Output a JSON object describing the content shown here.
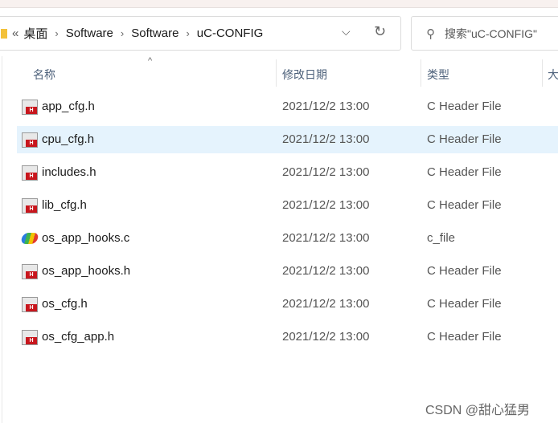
{
  "address_bar": {
    "overflow": "«",
    "crumbs": [
      "桌面",
      "Software",
      "Software",
      "uC-CONFIG"
    ],
    "separator": "›",
    "dropdown_icon": "chevron-down-icon",
    "refresh_icon": "refresh-icon"
  },
  "search": {
    "placeholder": "搜索\"uC-CONFIG\"",
    "icon": "search-icon"
  },
  "columns": {
    "name": "名称",
    "date": "修改日期",
    "type": "类型",
    "size": "大",
    "sort_indicator": "^"
  },
  "files": [
    {
      "name": "app_cfg.h",
      "date": "2021/12/2 13:00",
      "type": "C Header File",
      "icon": "h-file-icon",
      "selected": false
    },
    {
      "name": "cpu_cfg.h",
      "date": "2021/12/2 13:00",
      "type": "C Header File",
      "icon": "h-file-icon",
      "selected": true
    },
    {
      "name": "includes.h",
      "date": "2021/12/2 13:00",
      "type": "C Header File",
      "icon": "h-file-icon",
      "selected": false
    },
    {
      "name": "lib_cfg.h",
      "date": "2021/12/2 13:00",
      "type": "C Header File",
      "icon": "h-file-icon",
      "selected": false
    },
    {
      "name": "os_app_hooks.c",
      "date": "2021/12/2 13:00",
      "type": "c_file",
      "icon": "c-file-icon",
      "selected": false
    },
    {
      "name": "os_app_hooks.h",
      "date": "2021/12/2 13:00",
      "type": "C Header File",
      "icon": "h-file-icon",
      "selected": false
    },
    {
      "name": "os_cfg.h",
      "date": "2021/12/2 13:00",
      "type": "C Header File",
      "icon": "h-file-icon",
      "selected": false
    },
    {
      "name": "os_cfg_app.h",
      "date": "2021/12/2 13:00",
      "type": "C Header File",
      "icon": "h-file-icon",
      "selected": false
    }
  ],
  "watermark": "CSDN @甜心猛男",
  "colors": {
    "selection": "#e5f3fd",
    "header_text": "#4c607a"
  }
}
